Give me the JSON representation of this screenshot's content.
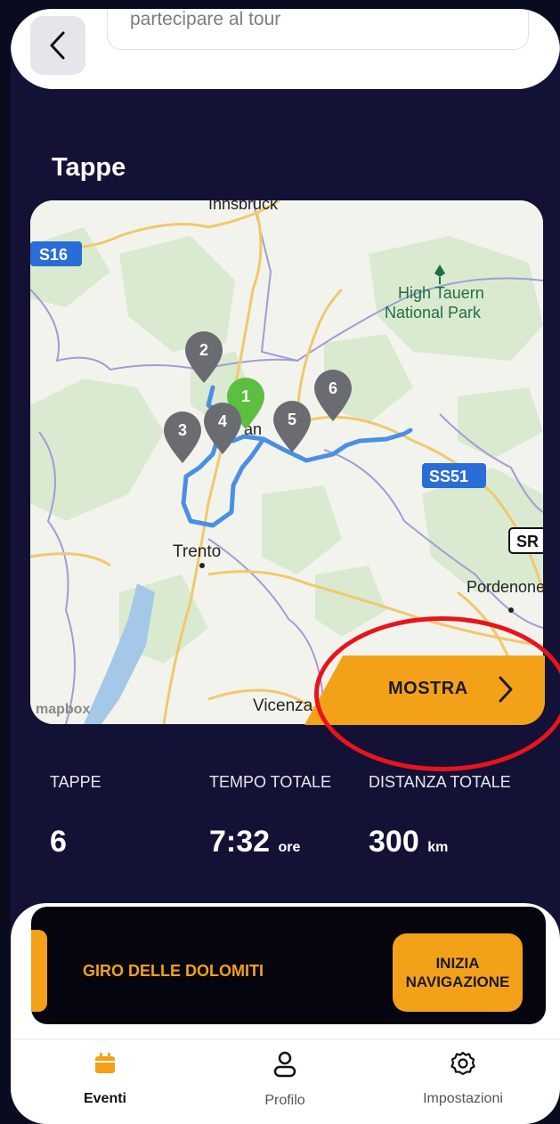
{
  "header": {
    "back_icon": "chevron-left-icon",
    "description_snippet": "partecipare al tour"
  },
  "section": {
    "title": "Tappe"
  },
  "map": {
    "labels": {
      "s16": "S16",
      "innsbruck": "Innsbruck",
      "park": "High Tauern\nNational Park",
      "park_line1": "High Tauern",
      "park_line2": "National Park",
      "ss51": "SS51",
      "sr": "SR",
      "trento": "Trento",
      "pordenone": "Pordenone",
      "vicenza": "Vicenza",
      "bolzano_fragment": "an",
      "attribution": "mapbox"
    },
    "markers": [
      "1",
      "2",
      "3",
      "4",
      "5",
      "6"
    ],
    "route_color": "#4a90e2",
    "start_marker_color": "#5cbf3f",
    "marker_color": "#6b6b72",
    "show_button": "MOSTRA"
  },
  "stats": {
    "stages_label": "TAPPE",
    "time_label": "TEMPO TOTALE",
    "distance_label": "DISTANZA TOTALE",
    "stages_value": "6",
    "time_value": "7:32",
    "time_unit": "ore",
    "distance_value": "300",
    "distance_unit": "km"
  },
  "tour": {
    "name": "GIRO DELLE DOLOMITI",
    "navigate_button": "INIZIA\nNAVIGAZIONE",
    "navigate_line1": "INIZIA",
    "navigate_line2": "NAVIGAZIONE"
  },
  "tabbar": {
    "events_label": "Eventi",
    "profile_label": "Profilo",
    "settings_label": "Impostazioni",
    "events_icon": "calendar-icon",
    "profile_icon": "user-icon",
    "settings_icon": "gear-icon"
  },
  "colors": {
    "background": "#131236",
    "accent": "#f4a11a",
    "highlight_ring": "#e8141b"
  }
}
